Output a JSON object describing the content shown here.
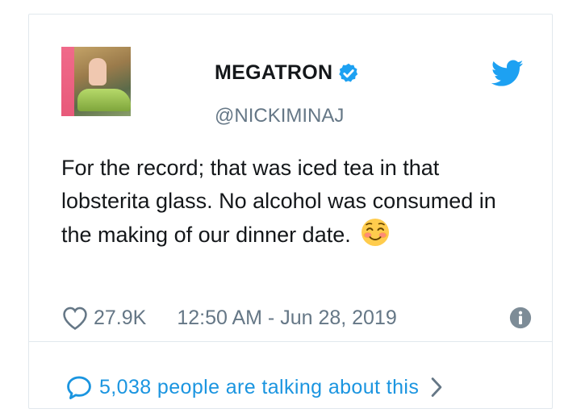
{
  "tweet": {
    "display_name": "MEGATRON",
    "handle": "@NICKIMINAJ",
    "text": "For the record; that was iced tea in that lobsterita glass. No alcohol was consumed in the making of our dinner date.",
    "emoji": "smiling-face-with-smiling-eyes",
    "likes": "27.9K",
    "timestamp": "12:50 AM - Jun 28, 2019",
    "conversation_link": "5,038 people are talking about this"
  },
  "colors": {
    "brand_blue": "#1da1f2",
    "link_blue": "#1b95e0",
    "muted_gray": "#657786",
    "text_dark": "#14171a"
  },
  "icons": {
    "verified": "verified-badge-icon",
    "brand": "twitter-bird-icon",
    "like": "heart-icon",
    "info": "info-icon",
    "reply": "speech-bubble-icon",
    "more": "chevron-right-icon"
  }
}
